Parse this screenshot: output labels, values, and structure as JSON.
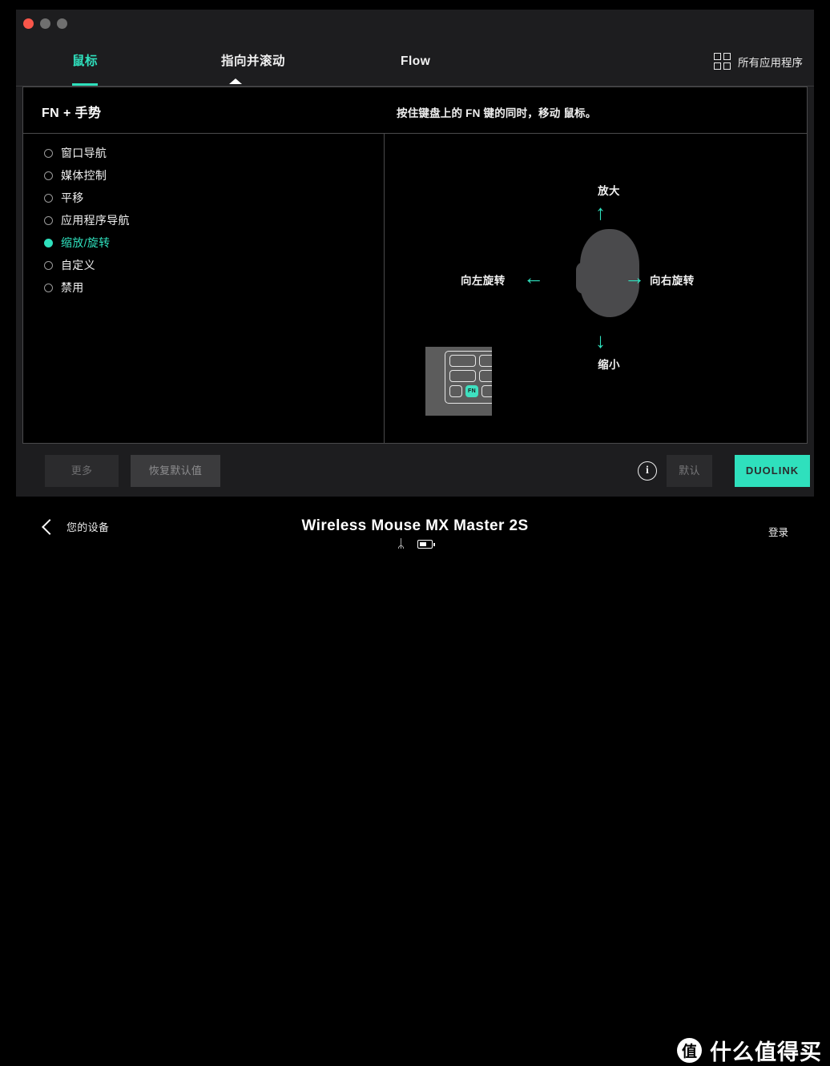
{
  "window": {
    "traffic_lights": [
      "close",
      "minimize",
      "maximize"
    ],
    "accent_color": "#2fe0bd"
  },
  "tabs": [
    {
      "label": "鼠标",
      "active": true
    },
    {
      "label": "指向并滚动",
      "active": false
    },
    {
      "label": "Flow",
      "active": false
    }
  ],
  "all_apps": {
    "label": "所有应用程序",
    "icon": "grid-icon"
  },
  "panel": {
    "title": "FN + 手势",
    "hint": "按住键盘上的 FN 键的同时，移动 鼠标。",
    "options": [
      {
        "label": "窗口导航",
        "selected": false
      },
      {
        "label": "媒体控制",
        "selected": false
      },
      {
        "label": "平移",
        "selected": false
      },
      {
        "label": "应用程序导航",
        "selected": false
      },
      {
        "label": "缩放/旋转",
        "selected": true
      },
      {
        "label": "自定义",
        "selected": false
      },
      {
        "label": "禁用",
        "selected": false
      }
    ],
    "preview": {
      "up_label": "放大",
      "down_label": "缩小",
      "left_label": "向左旋转",
      "right_label": "向右旋转",
      "arrow_up": "↑",
      "arrow_down": "↓",
      "arrow_left": "←",
      "arrow_right": "→",
      "keyboard_key": "FN"
    }
  },
  "footer": {
    "more_label": "更多",
    "reset_label": "恢复默认值",
    "info_glyph": "i",
    "default_label": "默认",
    "duolink_label": "DUOLINK"
  },
  "bottom_bar": {
    "back_label": "您的设备",
    "device_name": "Wireless Mouse MX Master 2S",
    "bluetooth_glyph": "ᛦ",
    "login_label": "登录"
  },
  "watermark": {
    "logo_char": "值",
    "text": "什么值得买"
  }
}
